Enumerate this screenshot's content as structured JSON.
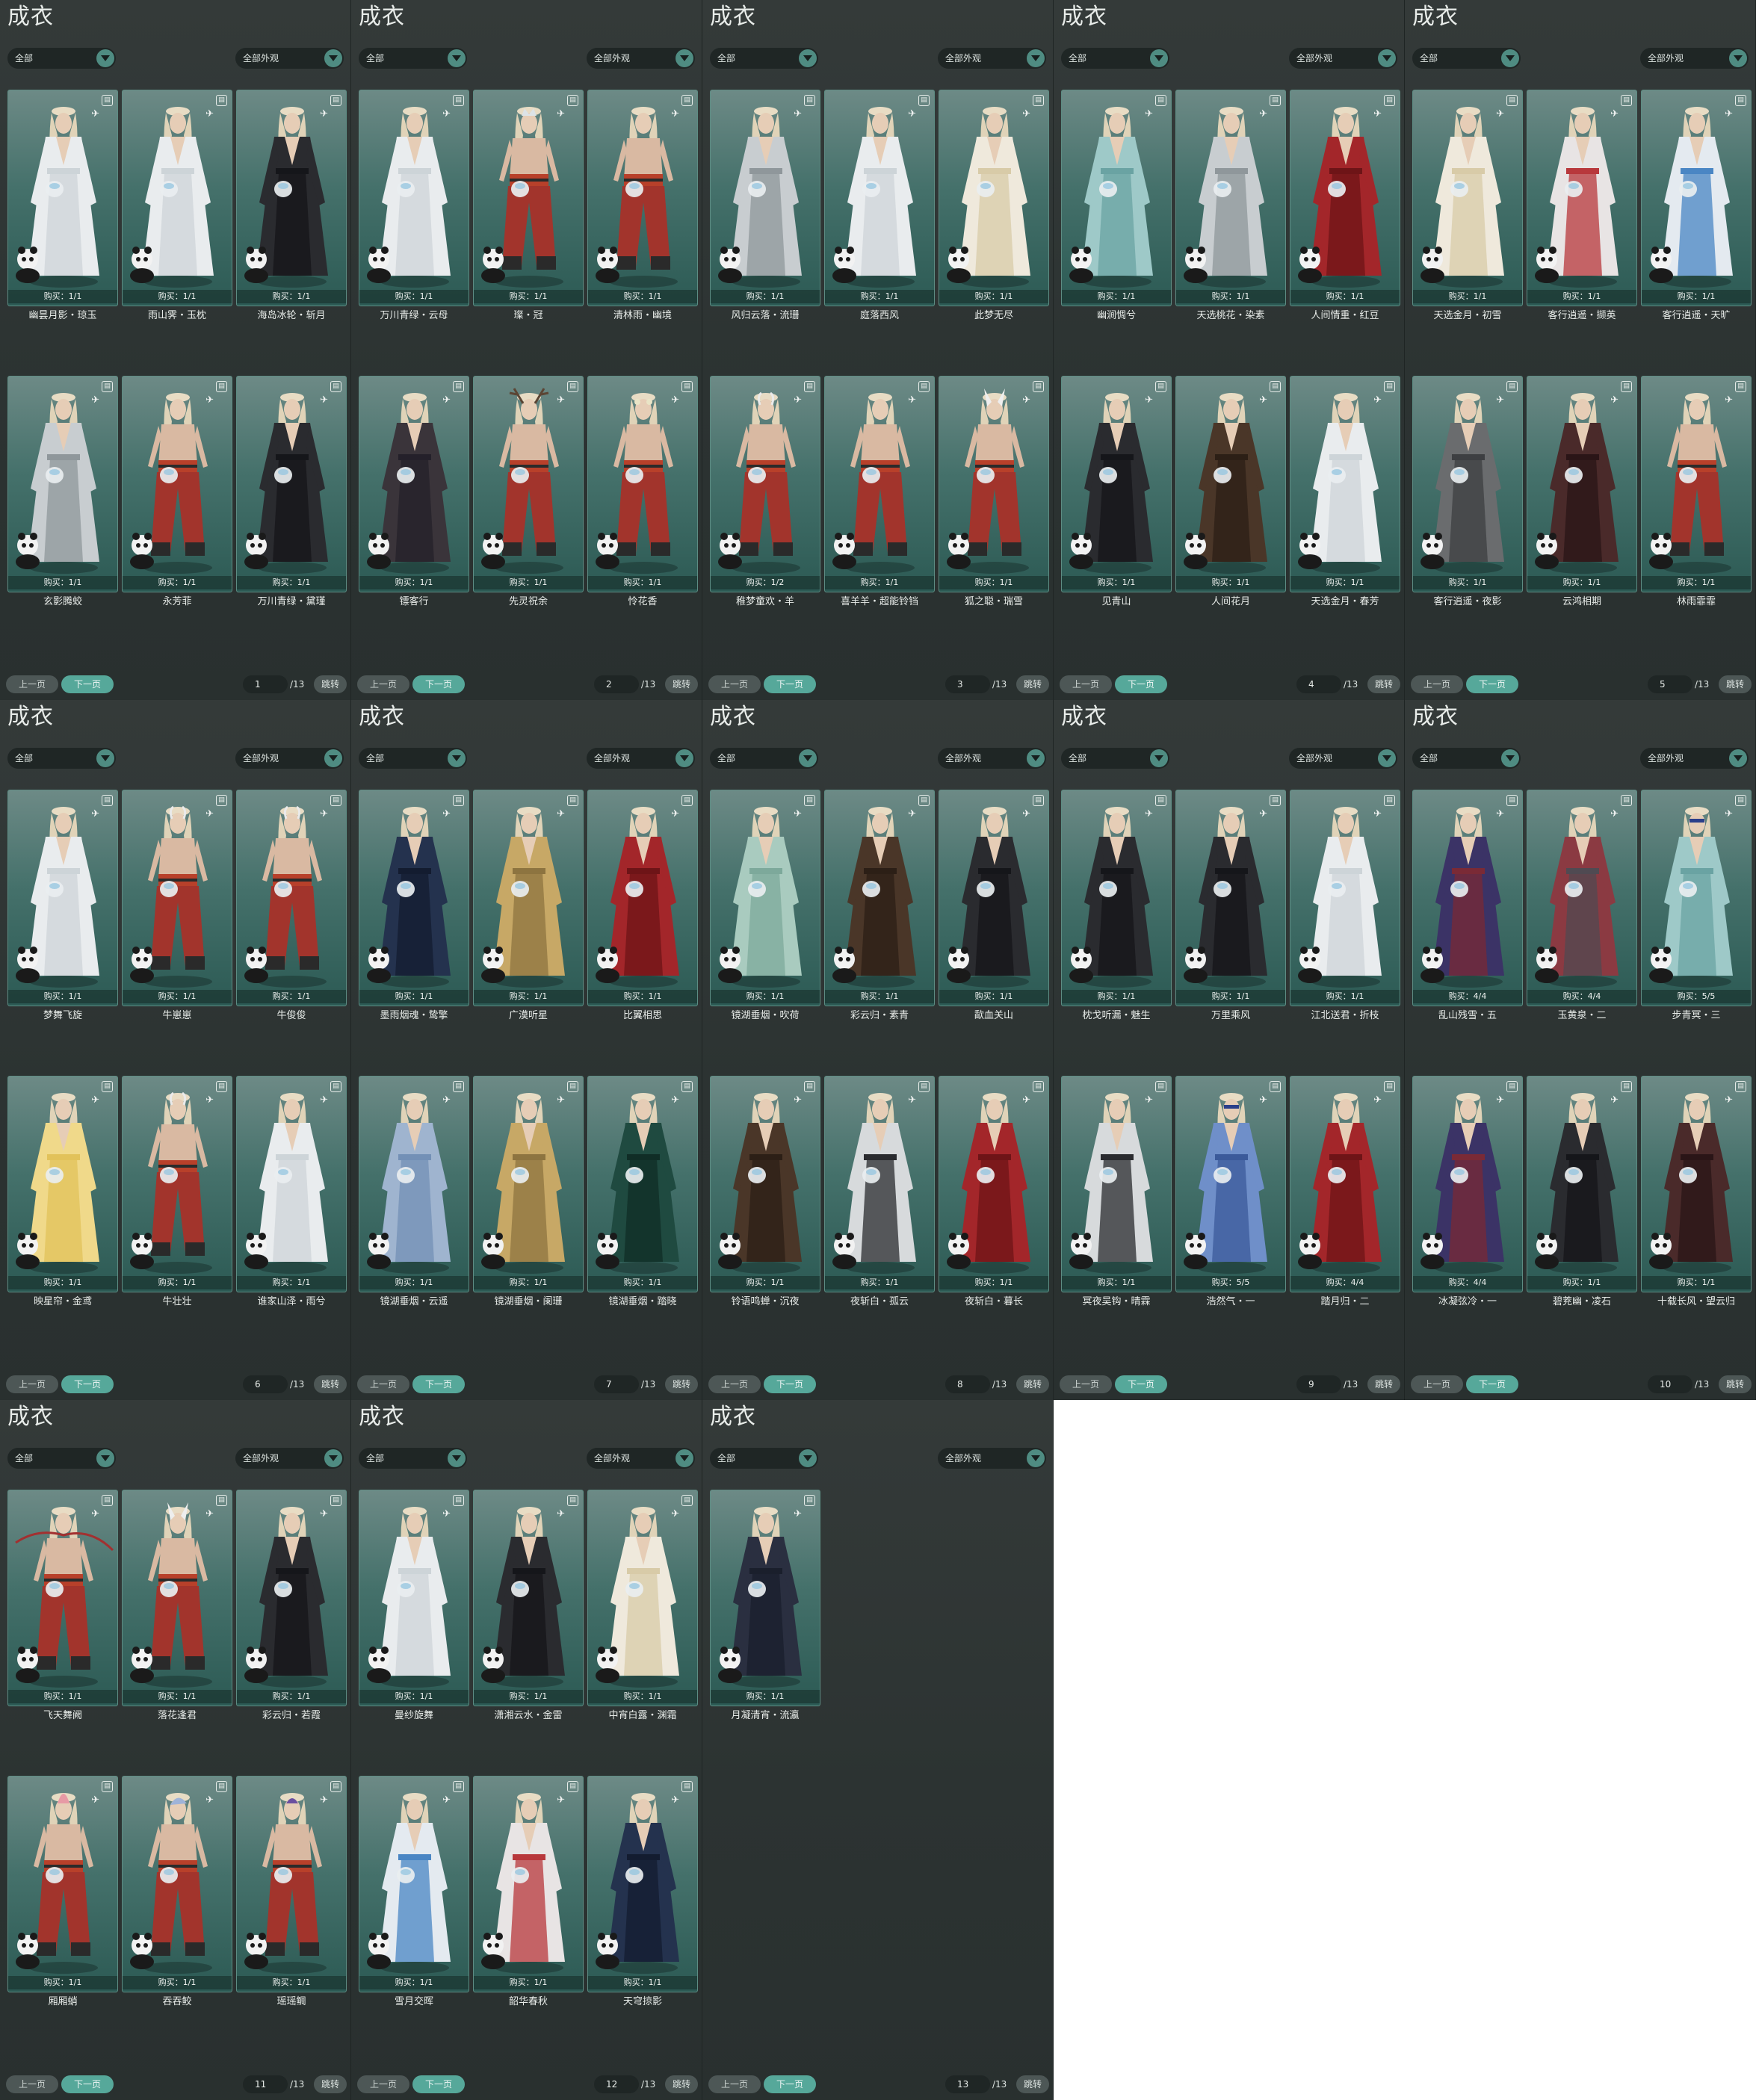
{
  "colors": {
    "panel_bg": "#2e3534",
    "card_bg": "#45716b",
    "accent": "#56a89a"
  },
  "icons": {
    "tag": "tag-icon",
    "bird": "bird-icon",
    "dropdown": "chevron-down-icon"
  },
  "panels": [
    {
      "title": "成衣",
      "filter_left": "全部",
      "filter_right": "全部外观",
      "page": "1",
      "total": "/13",
      "prev": "上一页",
      "next": "下一页",
      "jump": "跳转",
      "items": [
        {
          "name": "幽昙月影・琼玉",
          "buy": "购买：1/1",
          "outfit": "white",
          "head": "none"
        },
        {
          "name": "雨山霁・玉枕",
          "buy": "购买：1/1",
          "outfit": "white",
          "head": "none"
        },
        {
          "name": "海岛冰轮・斩月",
          "buy": "购买：1/1",
          "outfit": "black",
          "head": "none"
        },
        {
          "name": "玄影腾蛟",
          "buy": "购买：1/1",
          "outfit": "silver",
          "head": "none"
        },
        {
          "name": "永芳菲",
          "buy": "购买：1/1",
          "outfit": "bare",
          "head": "none"
        },
        {
          "name": "万川青绿・黛瑾",
          "buy": "购买：1/1",
          "outfit": "black",
          "head": "none"
        }
      ]
    },
    {
      "title": "成衣",
      "filter_left": "全部",
      "filter_right": "全部外观",
      "page": "2",
      "total": "/13",
      "prev": "上一页",
      "next": "下一页",
      "jump": "跳转",
      "items": [
        {
          "name": "万川青绿・云母",
          "buy": "购买：1/1",
          "outfit": "white",
          "head": "none"
        },
        {
          "name": "璨・冠",
          "buy": "购买：1/1",
          "outfit": "bare",
          "head": "crown"
        },
        {
          "name": "清林雨・幽境",
          "buy": "购买：1/1",
          "outfit": "bare",
          "head": "none"
        },
        {
          "name": "镖客行",
          "buy": "购买：1/1",
          "outfit": "dark",
          "head": "none"
        },
        {
          "name": "先灵祝余",
          "buy": "购买：1/1",
          "outfit": "bare",
          "head": "antler"
        },
        {
          "name": "怜花香",
          "buy": "购买：1/1",
          "outfit": "bare",
          "head": "flower"
        }
      ]
    },
    {
      "title": "成衣",
      "filter_left": "全部",
      "filter_right": "全部外观",
      "page": "3",
      "total": "/13",
      "prev": "上一页",
      "next": "下一页",
      "jump": "跳转",
      "items": [
        {
          "name": "风归云落・流珊",
          "buy": "购买：1/1",
          "outfit": "silver",
          "head": "none"
        },
        {
          "name": "庭落西风",
          "buy": "购买：1/1",
          "outfit": "white",
          "head": "none"
        },
        {
          "name": "此梦无尽",
          "buy": "购买：1/1",
          "outfit": "cream",
          "head": "none"
        },
        {
          "name": "稚梦童欢・羊",
          "buy": "购买：1/2",
          "outfit": "bare",
          "head": "horn"
        },
        {
          "name": "喜羊羊・超能铃铛",
          "buy": "购买：1/1",
          "outfit": "bare",
          "head": "none"
        },
        {
          "name": "狐之聪・瑞雪",
          "buy": "购买：1/1",
          "outfit": "bare",
          "head": "ears"
        }
      ]
    },
    {
      "title": "成衣",
      "filter_left": "全部",
      "filter_right": "全部外观",
      "page": "4",
      "total": "/13",
      "prev": "上一页",
      "next": "下一页",
      "jump": "跳转",
      "items": [
        {
          "name": "幽涧惆兮",
          "buy": "购买：1/1",
          "outfit": "teal",
          "head": "none"
        },
        {
          "name": "天选桃花・染素",
          "buy": "购买：1/1",
          "outfit": "silver",
          "head": "none"
        },
        {
          "name": "人间情重・红豆",
          "buy": "购买：1/1",
          "outfit": "red",
          "head": "none"
        },
        {
          "name": "见青山",
          "buy": "购买：1/1",
          "outfit": "black",
          "head": "none"
        },
        {
          "name": "人间花月",
          "buy": "购买：1/1",
          "outfit": "brown",
          "head": "none"
        },
        {
          "name": "天选金月・春芳",
          "buy": "购买：1/1",
          "outfit": "white",
          "head": "none"
        }
      ]
    },
    {
      "title": "成衣",
      "filter_left": "全部",
      "filter_right": "全部外观",
      "page": "5",
      "total": "/13",
      "prev": "上一页",
      "next": "下一页",
      "jump": "跳转",
      "items": [
        {
          "name": "天选金月・初雪",
          "buy": "购买：1/1",
          "outfit": "cream",
          "head": "none"
        },
        {
          "name": "客行逍遥・撷英",
          "buy": "购买：1/1",
          "outfit": "redwhite",
          "head": "none"
        },
        {
          "name": "客行逍遥・天旷",
          "buy": "购买：1/1",
          "outfit": "bluewhite",
          "head": "none"
        },
        {
          "name": "客行逍遥・夜影",
          "buy": "购买：1/1",
          "outfit": "gray",
          "head": "none"
        },
        {
          "name": "云鸿相期",
          "buy": "购买：1/1",
          "outfit": "darkred",
          "head": "none"
        },
        {
          "name": "林雨霏霏",
          "buy": "购买：1/1",
          "outfit": "bare",
          "head": "none"
        }
      ]
    },
    {
      "title": "成衣",
      "filter_left": "全部",
      "filter_right": "全部外观",
      "page": "6",
      "total": "/13",
      "prev": "上一页",
      "next": "下一页",
      "jump": "跳转",
      "items": [
        {
          "name": "梦舞飞旋",
          "buy": "购买：1/1",
          "outfit": "white",
          "head": "none"
        },
        {
          "name": "牛崽崽",
          "buy": "购买：1/1",
          "outfit": "bare",
          "head": "horn"
        },
        {
          "name": "牛俊俊",
          "buy": "购买：1/1",
          "outfit": "bare",
          "head": "horn"
        },
        {
          "name": "映星帘・金鸢",
          "buy": "购买：1/1",
          "outfit": "yellow",
          "head": "none"
        },
        {
          "name": "牛壮壮",
          "buy": "购买：1/1",
          "outfit": "bare",
          "head": "horn"
        },
        {
          "name": "谁家山泽・雨兮",
          "buy": "购买：1/1",
          "outfit": "white",
          "head": "none"
        }
      ]
    },
    {
      "title": "成衣",
      "filter_left": "全部",
      "filter_right": "全部外观",
      "page": "7",
      "total": "/13",
      "prev": "上一页",
      "next": "下一页",
      "jump": "跳转",
      "items": [
        {
          "name": "墨雨烟魂・鸷擎",
          "buy": "购买：1/1",
          "outfit": "navy",
          "head": "none"
        },
        {
          "name": "广漠听星",
          "buy": "购买：1/1",
          "outfit": "gold",
          "head": "none"
        },
        {
          "name": "比翼相思",
          "buy": "购买：1/1",
          "outfit": "red",
          "head": "none"
        },
        {
          "name": "镜湖垂烟・云遥",
          "buy": "购买：1/1",
          "outfit": "paleblue",
          "head": "none"
        },
        {
          "name": "镜湖垂烟・阑珊",
          "buy": "购买：1/1",
          "outfit": "gold",
          "head": "none"
        },
        {
          "name": "镜湖垂烟・踏晓",
          "buy": "购买：1/1",
          "outfit": "green",
          "head": "none"
        }
      ]
    },
    {
      "title": "成衣",
      "filter_left": "全部",
      "filter_right": "全部外观",
      "page": "8",
      "total": "/13",
      "prev": "上一页",
      "next": "下一页",
      "jump": "跳转",
      "items": [
        {
          "name": "镜湖垂烟・吹荷",
          "buy": "购买：1/1",
          "outfit": "mint",
          "head": "none"
        },
        {
          "name": "彩云归・素青",
          "buy": "购买：1/1",
          "outfit": "brown",
          "head": "none"
        },
        {
          "name": "歃血关山",
          "buy": "购买：1/1",
          "outfit": "black",
          "head": "none"
        },
        {
          "name": "铃语鸣蝉・沉夜",
          "buy": "购买：1/1",
          "outfit": "brown",
          "head": "none"
        },
        {
          "name": "夜斩白・孤云",
          "buy": "购买：1/1",
          "outfit": "whiteblack",
          "head": "none"
        },
        {
          "name": "夜斩白・暮长",
          "buy": "购买：1/1",
          "outfit": "red",
          "head": "none"
        }
      ]
    },
    {
      "title": "成衣",
      "filter_left": "全部",
      "filter_right": "全部外观",
      "page": "9",
      "total": "/13",
      "prev": "上一页",
      "next": "下一页",
      "jump": "跳转",
      "items": [
        {
          "name": "枕戈听漏・魅生",
          "buy": "购买：1/1",
          "outfit": "black",
          "head": "none"
        },
        {
          "name": "万里乘风",
          "buy": "购买：1/1",
          "outfit": "black",
          "head": "none"
        },
        {
          "name": "江北送君・折枝",
          "buy": "购买：1/1",
          "outfit": "white",
          "head": "none"
        },
        {
          "name": "冥夜吴钩・晴霖",
          "buy": "购买：1/1",
          "outfit": "whiteblack",
          "head": "none"
        },
        {
          "name": "浩然气・一",
          "buy": "购买：5/5",
          "outfit": "blue",
          "head": "band"
        },
        {
          "name": "踏月归・二",
          "buy": "购买：4/4",
          "outfit": "red",
          "head": "none"
        }
      ]
    },
    {
      "title": "成衣",
      "filter_left": "全部",
      "filter_right": "全部外观",
      "page": "10",
      "total": "/13",
      "prev": "上一页",
      "next": "下一页",
      "jump": "跳转",
      "items": [
        {
          "name": "乱山残雪・五",
          "buy": "购买：4/4",
          "outfit": "purple",
          "head": "none"
        },
        {
          "name": "玉黄泉・二",
          "buy": "购买：4/4",
          "outfit": "redgray",
          "head": "none"
        },
        {
          "name": "步青冥・三",
          "buy": "购买：5/5",
          "outfit": "teal",
          "head": "band"
        },
        {
          "name": "冰凝弦冷・一",
          "buy": "购买：4/4",
          "outfit": "purple",
          "head": "none"
        },
        {
          "name": "碧茺幽・凌石",
          "buy": "购买：1/1",
          "outfit": "black",
          "head": "none"
        },
        {
          "name": "十载长风・望云归",
          "buy": "购买：1/1",
          "outfit": "darkred",
          "head": "none"
        }
      ]
    },
    {
      "title": "成衣",
      "filter_left": "全部",
      "filter_right": "全部外观",
      "page": "11",
      "total": "/13",
      "prev": "上一页",
      "next": "下一页",
      "jump": "跳转",
      "items": [
        {
          "name": "飞天舞阙",
          "buy": "购买：1/1",
          "outfit": "bare",
          "head": "ribbon"
        },
        {
          "name": "落花逢君",
          "buy": "购买：1/1",
          "outfit": "bare",
          "head": "ears"
        },
        {
          "name": "彩云归・若霞",
          "buy": "购买：1/1",
          "outfit": "black",
          "head": "none"
        },
        {
          "name": "厢厢蛸",
          "buy": "购买：1/1",
          "outfit": "bare",
          "head": "pink"
        },
        {
          "name": "吞吞鲛",
          "buy": "购买：1/1",
          "outfit": "bare",
          "head": "fin"
        },
        {
          "name": "瑶瑶鲷",
          "buy": "购买：1/1",
          "outfit": "bare",
          "head": "purplehat"
        }
      ]
    },
    {
      "title": "成衣",
      "filter_left": "全部",
      "filter_right": "全部外观",
      "page": "12",
      "total": "/13",
      "prev": "上一页",
      "next": "下一页",
      "jump": "跳转",
      "items": [
        {
          "name": "曼纱旋舞",
          "buy": "购买：1/1",
          "outfit": "white",
          "head": "none"
        },
        {
          "name": "潇湘云水・金雷",
          "buy": "购买：1/1",
          "outfit": "black",
          "head": "none"
        },
        {
          "name": "中宵白露・渊霜",
          "buy": "购买：1/1",
          "outfit": "cream",
          "head": "none"
        },
        {
          "name": "雪月交晖",
          "buy": "购买：1/1",
          "outfit": "bluewhite",
          "head": "none"
        },
        {
          "name": "韶华春秋",
          "buy": "购买：1/1",
          "outfit": "redwhite",
          "head": "none"
        },
        {
          "name": "天穹掠影",
          "buy": "购买：1/1",
          "outfit": "navy",
          "head": "none"
        }
      ]
    },
    {
      "title": "成衣",
      "filter_left": "全部",
      "filter_right": "全部外观",
      "page": "13",
      "total": "/13",
      "prev": "上一页",
      "next": "下一页",
      "jump": "跳转",
      "items": [
        {
          "name": "月凝清宵・流瀛",
          "buy": "购买：1/1",
          "outfit": "navyvest",
          "head": "none"
        }
      ]
    }
  ]
}
